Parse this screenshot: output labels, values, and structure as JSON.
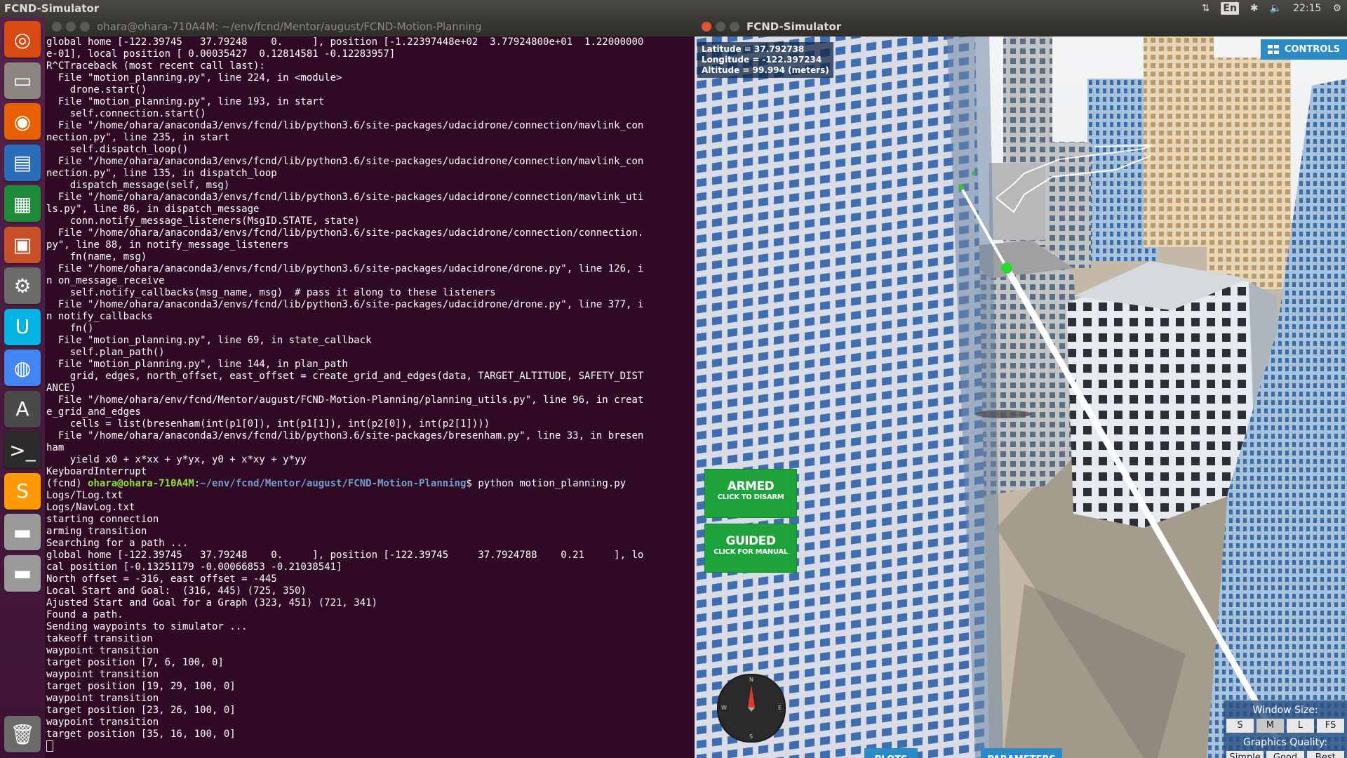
{
  "top_panel": {
    "app_title": "FCND-Simulator",
    "keyboard_layout": "En",
    "clock": "22:15"
  },
  "launcher": {
    "items": [
      {
        "name": "ubuntu-dash-icon",
        "glyph": "◎",
        "color": "#d84b12"
      },
      {
        "name": "files-icon",
        "glyph": "▭",
        "color": "#8b8680"
      },
      {
        "name": "firefox-icon",
        "glyph": "◉",
        "color": "#e66000"
      },
      {
        "name": "writer-icon",
        "glyph": "▤",
        "color": "#2a6ebb"
      },
      {
        "name": "calc-icon",
        "glyph": "▦",
        "color": "#1e8a3a"
      },
      {
        "name": "impress-icon",
        "glyph": "▣",
        "color": "#c8512a"
      },
      {
        "name": "settings-icon",
        "glyph": "⚙",
        "color": "#6b6b6b"
      },
      {
        "name": "udacity-icon",
        "glyph": "U",
        "color": "#02b3e4"
      },
      {
        "name": "chrome-icon",
        "glyph": "◍",
        "color": "#4285f4"
      },
      {
        "name": "software-updater-icon",
        "glyph": "A",
        "color": "#4a4a4a"
      },
      {
        "name": "terminal-icon",
        "glyph": ">_",
        "color": "#2b2b2b"
      },
      {
        "name": "sublime-icon",
        "glyph": "S",
        "color": "#ff9800"
      },
      {
        "name": "drive-icon",
        "glyph": "▬",
        "color": "#9a9a9a"
      },
      {
        "name": "drive-icon-2",
        "glyph": "▬",
        "color": "#9a9a9a"
      },
      {
        "name": "trash-icon",
        "glyph": "🗑",
        "color": "#6b6b6b"
      }
    ]
  },
  "terminal": {
    "title": "ohara@ohara-710A4M: ~/env/fcnd/Mentor/august/FCND-Motion-Planning",
    "lines_before": [
      "global home [-122.39745   37.79248    0.     ], position [-1.22397448e+02  3.77924800e+01  1.22000000",
      "e-01], local position [ 0.00035427  0.12814581 -0.12283957]",
      "R^CTraceback (most recent call last):",
      "  File \"motion_planning.py\", line 224, in <module>",
      "    drone.start()",
      "  File \"motion_planning.py\", line 193, in start",
      "    self.connection.start()",
      "  File \"/home/ohara/anaconda3/envs/fcnd/lib/python3.6/site-packages/udacidrone/connection/mavlink_con",
      "nection.py\", line 235, in start",
      "    self.dispatch_loop()",
      "  File \"/home/ohara/anaconda3/envs/fcnd/lib/python3.6/site-packages/udacidrone/connection/mavlink_con",
      "nection.py\", line 135, in dispatch_loop",
      "    dispatch_message(self, msg)",
      "  File \"/home/ohara/anaconda3/envs/fcnd/lib/python3.6/site-packages/udacidrone/connection/mavlink_uti",
      "ls.py\", line 86, in dispatch_message",
      "    conn.notify_message_listeners(MsgID.STATE, state)",
      "  File \"/home/ohara/anaconda3/envs/fcnd/lib/python3.6/site-packages/udacidrone/connection/connection.",
      "py\", line 88, in notify_message_listeners",
      "    fn(name, msg)",
      "  File \"/home/ohara/anaconda3/envs/fcnd/lib/python3.6/site-packages/udacidrone/drone.py\", line 126, i",
      "n on_message_receive",
      "    self.notify_callbacks(msg_name, msg)  # pass it along to these listeners",
      "  File \"/home/ohara/anaconda3/envs/fcnd/lib/python3.6/site-packages/udacidrone/drone.py\", line 377, i",
      "n notify_callbacks",
      "    fn()",
      "  File \"motion_planning.py\", line 69, in state_callback",
      "    self.plan_path()",
      "  File \"motion_planning.py\", line 144, in plan_path",
      "    grid, edges, north_offset, east_offset = create_grid_and_edges(data, TARGET_ALTITUDE, SAFETY_DIST",
      "ANCE)",
      "  File \"/home/ohara/env/fcnd/Mentor/august/FCND-Motion-Planning/planning_utils.py\", line 96, in creat",
      "e_grid_and_edges",
      "    cells = list(bresenham(int(p1[0]), int(p1[1]), int(p2[0]), int(p2[1])))",
      "  File \"/home/ohara/anaconda3/envs/fcnd/lib/python3.6/site-packages/bresenham.py\", line 33, in bresen",
      "ham",
      "    yield x0 + x*xx + y*yx, y0 + x*xy + y*yy",
      "KeyboardInterrupt"
    ],
    "prompt": {
      "env": "(fcnd) ",
      "user_host": "ohara@ohara-710A4M",
      "sep": ":",
      "path": "~/env/fcnd/Mentor/august/FCND-Motion-Planning",
      "dollar": "$ ",
      "command": "python motion_planning.py"
    },
    "lines_after": [
      "Logs/TLog.txt",
      "Logs/NavLog.txt",
      "starting connection",
      "arming transition",
      "Searching for a path ...",
      "global home [-122.39745   37.79248    0.     ], position [-122.39745     37.7924788    0.21     ], lo",
      "cal position [-0.13251179 -0.00066853 -0.21038541]",
      "North offset = -316, east offset = -445",
      "Local Start and Goal:  (316, 445) (725, 350)",
      "Ajusted Start and Goal for a Graph (323, 451) (721, 341)",
      "Found a path.",
      "Sending waypoints to simulator ...",
      "takeoff transition",
      "waypoint transition",
      "target position [7, 6, 100, 0]",
      "waypoint transition",
      "target position [19, 29, 100, 0]",
      "waypoint transition",
      "target position [23, 26, 100, 0]",
      "waypoint transition",
      "target position [35, 16, 100, 0]"
    ]
  },
  "simulator": {
    "title": "FCND-Simulator",
    "latitude": "Latitude = 37.792738",
    "longitude": "Longitude = -122.397234",
    "altitude": "Altitude = 99.994 (meters)",
    "controls_label": "CONTROLS",
    "armed_label": "ARMED",
    "armed_sub": "CLICK TO DISARM",
    "guided_label": "GUIDED",
    "guided_sub": "CLICK FOR MANUAL",
    "compass": {
      "n": "N",
      "s": "S",
      "e": "E",
      "w": "W"
    },
    "plots_label": "PLOTS",
    "parameters_label": "PARAMETERS",
    "window_size_label": "Window Size:",
    "window_sizes": [
      "S",
      "M",
      "L",
      "FS"
    ],
    "window_size_selected": "M",
    "graphics_quality_label": "Graphics Quality:",
    "graphics_qualities": [
      "Simple",
      "Good",
      "Best"
    ],
    "colors": {
      "accent": "#2a8bc7",
      "armed": "#1ea23c",
      "terminal_bg": "#300a24",
      "prompt_user": "#8ae234",
      "prompt_path": "#729fcf"
    }
  }
}
